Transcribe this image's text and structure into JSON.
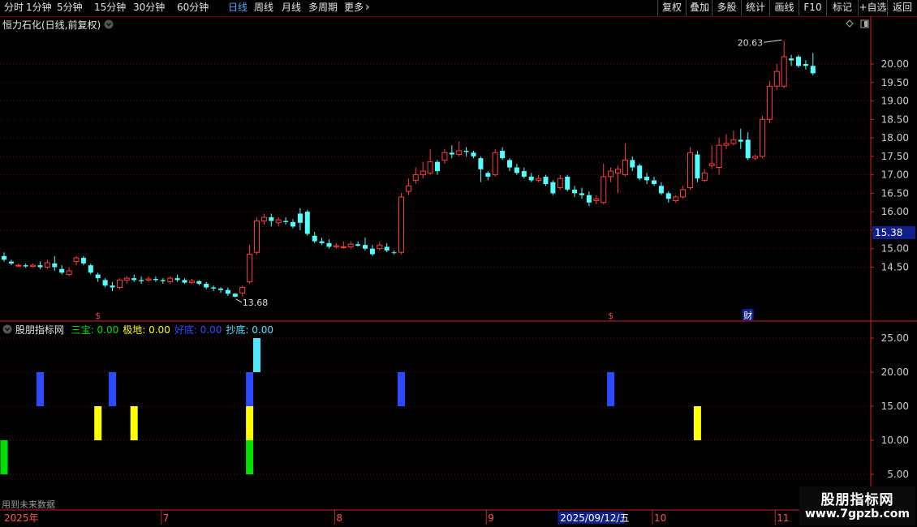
{
  "toolbar": {
    "periods": [
      "分时",
      "1分钟",
      "5分钟",
      "15分钟",
      "30分钟",
      "60分钟",
      "日线",
      "周线",
      "月线",
      "多周期",
      "更多"
    ],
    "active_period": "日线",
    "right_buttons": [
      "复权",
      "叠加",
      "多股",
      "统计",
      "画线",
      "F10",
      "标记",
      "+自选",
      "返回"
    ]
  },
  "chart_header": {
    "stock_title": "恒力石化(日线,前复权)"
  },
  "price_panel": {
    "current_price_tag": "15.38",
    "high_label": "20.63",
    "low_label": "13.68",
    "event_markers": [
      "$",
      "$",
      "财"
    ]
  },
  "indicator_legend": {
    "name": "股朋指标网",
    "items": [
      {
        "label": "三宝:",
        "value": "0.00",
        "color": "#00e000"
      },
      {
        "label": "极地:",
        "value": "0.00",
        "color": "#ffff00"
      },
      {
        "label": "好底:",
        "value": "0.00",
        "color": "#2a4bff"
      },
      {
        "label": "抄底:",
        "value": "0.00",
        "color": "#4fe6ff"
      }
    ]
  },
  "footer": {
    "future_note": "用到未来数据",
    "time_labels": [
      "2025年",
      "7",
      "8",
      "9",
      "2025/09/12/五",
      "10",
      "11"
    ]
  },
  "watermark": {
    "line1": "股朋指标网",
    "line2": "www.7gpzb.com"
  },
  "colors": {
    "up": "#ff3c3c",
    "down": "#54ffff",
    "grid": "#7a0000",
    "axis": "#cc2020",
    "bg": "#000000"
  },
  "chart_data": [
    {
      "type": "candlestick",
      "title": "恒力石化(日线,前复权)",
      "ylim": [
        13.5,
        20.9
      ],
      "yticks": [
        14.5,
        15.0,
        15.5,
        16.0,
        16.5,
        17.0,
        17.5,
        18.0,
        18.5,
        19.0,
        19.5,
        20.0
      ],
      "annotations": [
        {
          "text": "20.63",
          "kind": "high"
        },
        {
          "text": "13.68",
          "kind": "low"
        }
      ],
      "candles": [
        {
          "o": 14.8,
          "c": 14.7,
          "h": 14.9,
          "l": 14.65
        },
        {
          "o": 14.65,
          "c": 14.6,
          "h": 14.7,
          "l": 14.55
        },
        {
          "o": 14.55,
          "c": 14.55,
          "h": 14.6,
          "l": 14.5
        },
        {
          "o": 14.55,
          "c": 14.52,
          "h": 14.6,
          "l": 14.48
        },
        {
          "o": 14.52,
          "c": 14.55,
          "h": 14.6,
          "l": 14.5
        },
        {
          "o": 14.55,
          "c": 14.5,
          "h": 14.65,
          "l": 14.45
        },
        {
          "o": 14.5,
          "c": 14.62,
          "h": 14.7,
          "l": 14.45
        },
        {
          "o": 14.6,
          "c": 14.5,
          "h": 14.8,
          "l": 14.4
        },
        {
          "o": 14.45,
          "c": 14.35,
          "h": 14.55,
          "l": 14.3
        },
        {
          "o": 14.3,
          "c": 14.4,
          "h": 14.5,
          "l": 14.25
        },
        {
          "o": 14.65,
          "c": 14.75,
          "h": 14.8,
          "l": 14.55
        },
        {
          "o": 14.75,
          "c": 14.6,
          "h": 14.8,
          "l": 14.55
        },
        {
          "o": 14.55,
          "c": 14.35,
          "h": 14.6,
          "l": 14.3
        },
        {
          "o": 14.3,
          "c": 14.2,
          "h": 14.35,
          "l": 14.1
        },
        {
          "o": 14.15,
          "c": 14.0,
          "h": 14.2,
          "l": 13.95
        },
        {
          "o": 14.0,
          "c": 13.95,
          "h": 14.1,
          "l": 13.85
        },
        {
          "o": 13.95,
          "c": 14.15,
          "h": 14.2,
          "l": 13.9
        },
        {
          "o": 14.15,
          "c": 14.2,
          "h": 14.25,
          "l": 14.05
        },
        {
          "o": 14.2,
          "c": 14.15,
          "h": 14.3,
          "l": 14.1
        },
        {
          "o": 14.15,
          "c": 14.12,
          "h": 14.25,
          "l": 14.05
        },
        {
          "o": 14.15,
          "c": 14.18,
          "h": 14.25,
          "l": 14.1
        },
        {
          "o": 14.18,
          "c": 14.15,
          "h": 14.25,
          "l": 14.1
        },
        {
          "o": 14.15,
          "c": 14.12,
          "h": 14.2,
          "l": 14.05
        },
        {
          "o": 14.1,
          "c": 14.2,
          "h": 14.25,
          "l": 14.05
        },
        {
          "o": 14.2,
          "c": 14.15,
          "h": 14.3,
          "l": 14.1
        },
        {
          "o": 14.15,
          "c": 14.08,
          "h": 14.2,
          "l": 14.05
        },
        {
          "o": 14.08,
          "c": 14.12,
          "h": 14.18,
          "l": 14.05
        },
        {
          "o": 14.12,
          "c": 14.05,
          "h": 14.15,
          "l": 14.0
        },
        {
          "o": 14.05,
          "c": 13.95,
          "h": 14.1,
          "l": 13.9
        },
        {
          "o": 13.95,
          "c": 13.92,
          "h": 14.0,
          "l": 13.85
        },
        {
          "o": 13.92,
          "c": 13.88,
          "h": 13.95,
          "l": 13.8
        },
        {
          "o": 13.88,
          "c": 13.78,
          "h": 13.95,
          "l": 13.72
        },
        {
          "o": 13.78,
          "c": 13.7,
          "h": 13.8,
          "l": 13.68
        },
        {
          "o": 13.8,
          "c": 13.95,
          "h": 14.0,
          "l": 13.7
        },
        {
          "o": 14.1,
          "c": 14.85,
          "h": 15.1,
          "l": 14.05
        },
        {
          "o": 14.9,
          "c": 15.75,
          "h": 15.85,
          "l": 14.85
        },
        {
          "o": 15.75,
          "c": 15.85,
          "h": 15.95,
          "l": 15.65
        },
        {
          "o": 15.85,
          "c": 15.75,
          "h": 15.95,
          "l": 15.6
        },
        {
          "o": 15.7,
          "c": 15.78,
          "h": 15.85,
          "l": 15.6
        },
        {
          "o": 15.75,
          "c": 15.72,
          "h": 15.85,
          "l": 15.65
        },
        {
          "o": 15.72,
          "c": 15.6,
          "h": 15.8,
          "l": 15.55
        },
        {
          "o": 15.95,
          "c": 15.7,
          "h": 16.1,
          "l": 15.5
        },
        {
          "o": 16.0,
          "c": 15.4,
          "h": 16.05,
          "l": 15.35
        },
        {
          "o": 15.35,
          "c": 15.2,
          "h": 15.45,
          "l": 15.15
        },
        {
          "o": 15.2,
          "c": 15.15,
          "h": 15.3,
          "l": 15.1
        },
        {
          "o": 15.15,
          "c": 15.05,
          "h": 15.25,
          "l": 15.0
        },
        {
          "o": 15.05,
          "c": 15.08,
          "h": 15.15,
          "l": 15.0
        },
        {
          "o": 15.05,
          "c": 15.05,
          "h": 15.2,
          "l": 15.0
        },
        {
          "o": 15.05,
          "c": 15.12,
          "h": 15.2,
          "l": 15.0
        },
        {
          "o": 15.12,
          "c": 15.08,
          "h": 15.2,
          "l": 15.05
        },
        {
          "o": 15.1,
          "c": 15.0,
          "h": 15.3,
          "l": 14.95
        },
        {
          "o": 15.0,
          "c": 14.85,
          "h": 15.1,
          "l": 14.8
        },
        {
          "o": 15.0,
          "c": 15.1,
          "h": 15.2,
          "l": 14.95
        },
        {
          "o": 15.05,
          "c": 14.95,
          "h": 15.15,
          "l": 14.9
        },
        {
          "o": 14.9,
          "c": 14.88,
          "h": 14.95,
          "l": 14.85
        },
        {
          "o": 14.9,
          "c": 16.4,
          "h": 16.5,
          "l": 14.85
        },
        {
          "o": 16.55,
          "c": 16.7,
          "h": 16.9,
          "l": 16.45
        },
        {
          "o": 16.85,
          "c": 17.0,
          "h": 17.2,
          "l": 16.75
        },
        {
          "o": 17.0,
          "c": 17.1,
          "h": 17.35,
          "l": 16.9
        },
        {
          "o": 17.05,
          "c": 17.35,
          "h": 17.7,
          "l": 17.0
        },
        {
          "o": 17.35,
          "c": 17.1,
          "h": 17.4,
          "l": 17.0
        },
        {
          "o": 17.4,
          "c": 17.6,
          "h": 17.7,
          "l": 17.3
        },
        {
          "o": 17.6,
          "c": 17.55,
          "h": 17.8,
          "l": 17.45
        },
        {
          "o": 17.55,
          "c": 17.65,
          "h": 17.9,
          "l": 17.5
        },
        {
          "o": 17.65,
          "c": 17.62,
          "h": 17.75,
          "l": 17.5
        },
        {
          "o": 17.6,
          "c": 17.5,
          "h": 17.65,
          "l": 17.45
        },
        {
          "o": 17.45,
          "c": 17.15,
          "h": 17.5,
          "l": 16.8
        },
        {
          "o": 17.05,
          "c": 16.95,
          "h": 17.1,
          "l": 16.85
        },
        {
          "o": 17.0,
          "c": 17.6,
          "h": 17.7,
          "l": 16.95
        },
        {
          "o": 17.65,
          "c": 17.45,
          "h": 17.75,
          "l": 17.4
        },
        {
          "o": 17.4,
          "c": 17.2,
          "h": 17.45,
          "l": 17.1
        },
        {
          "o": 17.2,
          "c": 17.05,
          "h": 17.3,
          "l": 17.0
        },
        {
          "o": 17.1,
          "c": 16.95,
          "h": 17.2,
          "l": 16.9
        },
        {
          "o": 16.95,
          "c": 16.85,
          "h": 17.05,
          "l": 16.8
        },
        {
          "o": 16.85,
          "c": 16.9,
          "h": 17.0,
          "l": 16.8
        },
        {
          "o": 16.95,
          "c": 16.75,
          "h": 17.0,
          "l": 16.7
        },
        {
          "o": 16.8,
          "c": 16.5,
          "h": 16.85,
          "l": 16.45
        },
        {
          "o": 16.65,
          "c": 16.9,
          "h": 17.0,
          "l": 16.6
        },
        {
          "o": 16.95,
          "c": 16.6,
          "h": 17.0,
          "l": 16.55
        },
        {
          "o": 16.6,
          "c": 16.5,
          "h": 16.7,
          "l": 16.4
        },
        {
          "o": 16.5,
          "c": 16.45,
          "h": 16.65,
          "l": 16.35
        },
        {
          "o": 16.45,
          "c": 16.25,
          "h": 16.55,
          "l": 16.15
        },
        {
          "o": 16.3,
          "c": 16.35,
          "h": 16.45,
          "l": 16.2
        },
        {
          "o": 16.25,
          "c": 16.95,
          "h": 17.3,
          "l": 16.2
        },
        {
          "o": 16.95,
          "c": 17.1,
          "h": 17.2,
          "l": 16.8
        },
        {
          "o": 17.05,
          "c": 17.15,
          "h": 17.25,
          "l": 16.5
        },
        {
          "o": 17.0,
          "c": 17.4,
          "h": 17.85,
          "l": 16.95
        },
        {
          "o": 17.4,
          "c": 17.2,
          "h": 17.5,
          "l": 17.1
        },
        {
          "o": 17.25,
          "c": 16.9,
          "h": 17.3,
          "l": 16.85
        },
        {
          "o": 16.95,
          "c": 16.85,
          "h": 17.05,
          "l": 16.75
        },
        {
          "o": 16.85,
          "c": 16.75,
          "h": 16.95,
          "l": 16.7
        },
        {
          "o": 16.7,
          "c": 16.5,
          "h": 16.8,
          "l": 16.45
        },
        {
          "o": 16.5,
          "c": 16.35,
          "h": 16.55,
          "l": 16.25
        },
        {
          "o": 16.3,
          "c": 16.4,
          "h": 16.45,
          "l": 16.25
        },
        {
          "o": 16.4,
          "c": 16.6,
          "h": 16.7,
          "l": 16.35
        },
        {
          "o": 16.65,
          "c": 17.6,
          "h": 17.75,
          "l": 16.6
        },
        {
          "o": 17.55,
          "c": 16.9,
          "h": 17.65,
          "l": 16.8
        },
        {
          "o": 16.85,
          "c": 17.05,
          "h": 17.15,
          "l": 16.8
        },
        {
          "o": 17.25,
          "c": 17.3,
          "h": 17.8,
          "l": 17.15
        },
        {
          "o": 17.2,
          "c": 17.8,
          "h": 18.0,
          "l": 17.0
        },
        {
          "o": 17.8,
          "c": 17.85,
          "h": 18.1,
          "l": 17.7
        },
        {
          "o": 17.85,
          "c": 17.95,
          "h": 18.2,
          "l": 17.8
        },
        {
          "o": 17.95,
          "c": 17.9,
          "h": 18.25,
          "l": 17.7
        },
        {
          "o": 17.95,
          "c": 17.45,
          "h": 18.15,
          "l": 17.4
        },
        {
          "o": 17.45,
          "c": 17.5,
          "h": 17.55,
          "l": 17.4
        },
        {
          "o": 17.5,
          "c": 18.5,
          "h": 18.6,
          "l": 17.45
        },
        {
          "o": 18.5,
          "c": 19.4,
          "h": 19.55,
          "l": 18.4
        },
        {
          "o": 19.4,
          "c": 19.8,
          "h": 20.0,
          "l": 19.3
        },
        {
          "o": 19.4,
          "c": 20.2,
          "h": 20.63,
          "l": 19.35
        },
        {
          "o": 20.15,
          "c": 20.1,
          "h": 20.25,
          "l": 19.95
        },
        {
          "o": 20.2,
          "c": 19.95,
          "h": 20.25,
          "l": 19.9
        },
        {
          "o": 20.0,
          "c": 19.95,
          "h": 20.1,
          "l": 19.85
        },
        {
          "o": 19.95,
          "c": 19.75,
          "h": 20.3,
          "l": 19.7
        }
      ]
    },
    {
      "type": "bar",
      "title": "股朋指标网",
      "ylim": [
        0,
        27
      ],
      "yticks": [
        5.0,
        10.0,
        15.0,
        20.0,
        25.0
      ],
      "series": [
        {
          "name": "三宝",
          "color": "#00e000",
          "level": 5,
          "indices": [
            0,
            34
          ]
        },
        {
          "name": "极地",
          "color": "#ffff00",
          "level": 10,
          "indices": [
            13,
            18,
            34,
            96
          ]
        },
        {
          "name": "好底",
          "color": "#2a4bff",
          "level": 15,
          "indices": [
            5,
            15,
            34,
            55,
            84
          ]
        },
        {
          "name": "抄底",
          "color": "#4fe6ff",
          "level": 20,
          "indices": [
            35
          ]
        }
      ]
    }
  ]
}
